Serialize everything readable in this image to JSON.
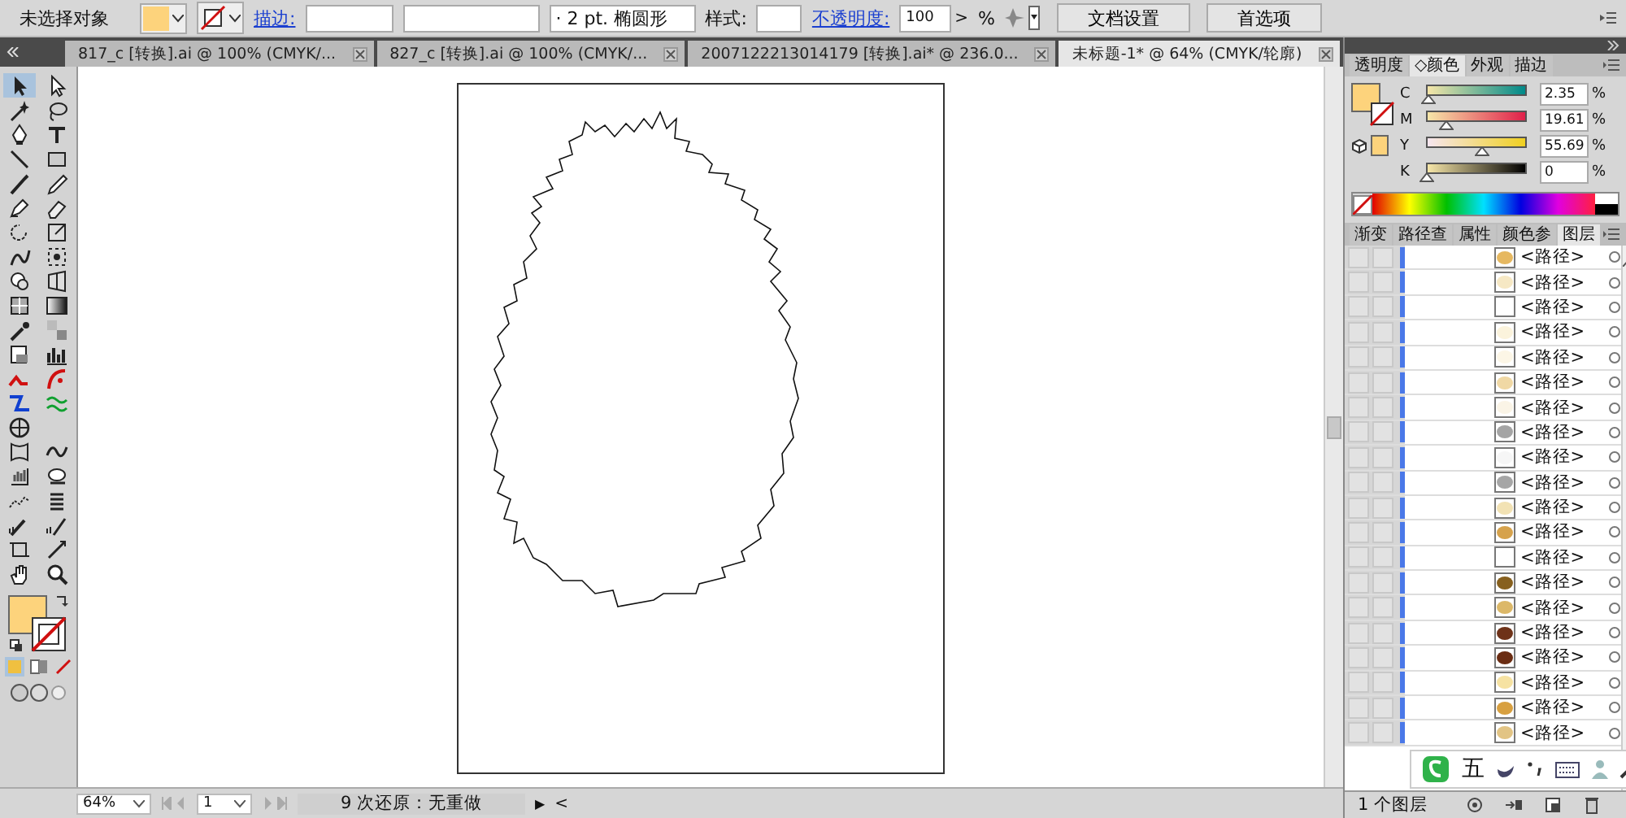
{
  "control_bar": {
    "selection": "未选择对象",
    "fill": {
      "color": "#fdd37c"
    },
    "stroke_label": "描边:",
    "brush": "· 2 pt. 椭圆形",
    "style_label": "样式:",
    "opacity_label": "不透明度:",
    "opacity": "100",
    "opacity_arrow": ">",
    "percent": "%",
    "buttons": [
      "文档设置",
      "首选项"
    ]
  },
  "tabs": [
    {
      "label": "817_c [转换].ai @ 100% (CMYK/...",
      "selected": false
    },
    {
      "label": "827_c [转换].ai @ 100% (CMYK/...",
      "selected": false
    },
    {
      "label": "2007122213014179  [转换].ai* @ 236.0...",
      "selected": false
    },
    {
      "label": "未标题-1* @ 64% (CMYK/轮廓)",
      "selected": true
    }
  ],
  "tools": [
    {
      "kind": "arrow",
      "selected": true
    },
    {
      "kind": "hollow-arrow",
      "selected": false
    },
    {
      "kind": "wand",
      "selected": false
    },
    {
      "kind": "lasso",
      "selected": false
    },
    {
      "kind": "pen",
      "selected": false
    },
    {
      "kind": "type",
      "selected": false
    },
    {
      "kind": "line",
      "selected": false
    },
    {
      "kind": "rect",
      "selected": false
    },
    {
      "kind": "brush",
      "selected": false
    },
    {
      "kind": "pencil",
      "selected": false
    },
    {
      "kind": "blob",
      "selected": false
    },
    {
      "kind": "eraser",
      "selected": false
    },
    {
      "kind": "rotate",
      "selected": false
    },
    {
      "kind": "scale",
      "selected": false
    },
    {
      "kind": "warp",
      "selected": false
    },
    {
      "kind": "transform",
      "selected": false
    },
    {
      "kind": "builder",
      "selected": false
    },
    {
      "kind": "perspective",
      "selected": false
    },
    {
      "kind": "mesh",
      "selected": false
    },
    {
      "kind": "gradient",
      "selected": false
    },
    {
      "kind": "eyedropper",
      "selected": false
    },
    {
      "kind": "blend",
      "selected": false
    },
    {
      "kind": "symbol",
      "selected": false
    },
    {
      "kind": "graph",
      "selected": false
    },
    {
      "kind": "red-curve",
      "selected": false
    },
    {
      "kind": "red-arc",
      "selected": false
    },
    {
      "kind": "blue-zigzag",
      "selected": false
    },
    {
      "kind": "green-wave",
      "selected": false
    },
    {
      "kind": "crosshair",
      "selected": false
    },
    {
      "kind": "envelope",
      "selected": false
    },
    {
      "kind": "wave",
      "selected": false
    },
    {
      "kind": "grid",
      "selected": false
    },
    {
      "kind": "stamp",
      "selected": false
    },
    {
      "kind": "dots",
      "selected": false
    },
    {
      "kind": "bars",
      "selected": false
    },
    {
      "kind": "dropper-bars",
      "selected": false
    },
    {
      "kind": "pen-bars",
      "selected": false
    },
    {
      "kind": "artboard",
      "selected": false
    },
    {
      "kind": "slice",
      "selected": false
    },
    {
      "kind": "hand",
      "selected": false
    },
    {
      "kind": "zoom",
      "selected": false
    }
  ],
  "toolbox_fill": {
    "color": "#fdd37c"
  },
  "draw_modes": [
    {
      "kind": "normal",
      "selected": true
    },
    {
      "kind": "behind",
      "selected": false
    },
    {
      "kind": "inside",
      "selected": false
    }
  ],
  "color_panel": {
    "tabs": [
      {
        "label": "透明度",
        "selected": false
      },
      {
        "label": "◇颜色",
        "selected": true
      },
      {
        "label": "外观",
        "selected": false
      },
      {
        "label": "描边",
        "selected": false
      }
    ],
    "fill": {
      "color": "#fdd37c"
    },
    "channels": [
      {
        "name": "C",
        "level": 0.0235,
        "value": "2.35",
        "percent": "%"
      },
      {
        "name": "M",
        "level": 0.1961,
        "value": "19.61",
        "percent": "%"
      },
      {
        "name": "Y",
        "level": 0.5569,
        "value": "55.69",
        "percent": "%"
      },
      {
        "name": "K",
        "level": 0,
        "value": "0",
        "percent": "%"
      }
    ]
  },
  "layers_panel": {
    "tabs": [
      {
        "label": "渐变",
        "selected": false
      },
      {
        "label": "路径查",
        "selected": false
      },
      {
        "label": "属性",
        "selected": false
      },
      {
        "label": "颜色参",
        "selected": false
      },
      {
        "label": "图层",
        "selected": true
      }
    ],
    "rows": [
      {
        "name": "<路径>",
        "color": "#e6b860"
      },
      {
        "name": "<路径>",
        "color": "#f6e8c4"
      },
      {
        "name": "<路径>",
        "color": "#ffffff"
      },
      {
        "name": "<路径>",
        "color": "#fbf3dc"
      },
      {
        "name": "<路径>",
        "color": "#fcf6e6"
      },
      {
        "name": "<路径>",
        "color": "#f0d8a4"
      },
      {
        "name": "<路径>",
        "color": "#faf4e6"
      },
      {
        "name": "<路径>",
        "color": "#a4a4a4"
      },
      {
        "name": "<路径>",
        "color": "#f6f6f6"
      },
      {
        "name": "<路径>",
        "color": "#a6a6a6"
      },
      {
        "name": "<路径>",
        "color": "#f2e2b4"
      },
      {
        "name": "<路径>",
        "color": "#d6a24c"
      },
      {
        "name": "<路径>",
        "color": "#fefefe"
      },
      {
        "name": "<路径>",
        "color": "#87601e"
      },
      {
        "name": "<路径>",
        "color": "#dcb868"
      },
      {
        "name": "<路径>",
        "color": "#6e3218"
      },
      {
        "name": "<路径>",
        "color": "#6a2c12"
      },
      {
        "name": "<路径>",
        "color": "#f6e2a2"
      },
      {
        "name": "<路径>",
        "color": "#d8a040"
      },
      {
        "name": "<路径>",
        "color": "#e2c484"
      }
    ],
    "footer": "1 个图层"
  },
  "ime": {
    "mode": "五"
  },
  "status_bar": {
    "zoom": "64%",
    "page": "1",
    "message": "9 次还原：无重做",
    "play": "▶",
    "scroll_left": "<"
  }
}
